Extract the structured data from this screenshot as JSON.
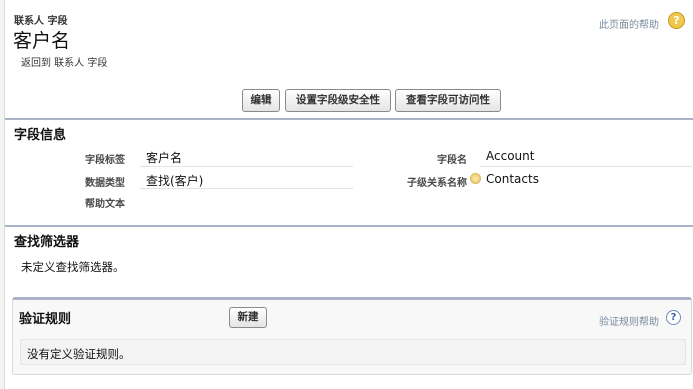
{
  "header": {
    "object_type": "联系人 字段",
    "title": "客户名",
    "back_link": "返回到 联系人 字段",
    "help_link": "此页面的帮助",
    "help_icon": "question-icon"
  },
  "toolbar": {
    "edit_label": "编辑",
    "security_label": "设置字段级安全性",
    "accessibility_label": "查看字段可访问性"
  },
  "field_info": {
    "section_title": "字段信息",
    "left": [
      {
        "label": "字段标签",
        "value": "客户名"
      },
      {
        "label": "数据类型",
        "value": "查找(客户)"
      },
      {
        "label": "帮助文本",
        "value": ""
      }
    ],
    "right": [
      {
        "label": "字段名",
        "value": "Account"
      },
      {
        "label": "子级关系名称",
        "value": "Contacts"
      }
    ]
  },
  "lookup_filter": {
    "section_title": "查找筛选器",
    "message": "未定义查找筛选器。"
  },
  "validation_rules": {
    "section_title": "验证规则",
    "new_label": "新建",
    "help_link": "验证规则帮助",
    "help_icon": "question-icon",
    "empty_message": "没有定义验证规则。"
  },
  "colors": {
    "section_rule": "#a9b3c5",
    "help_link": "#7a8a9c",
    "help_badge": "#f0c850"
  }
}
